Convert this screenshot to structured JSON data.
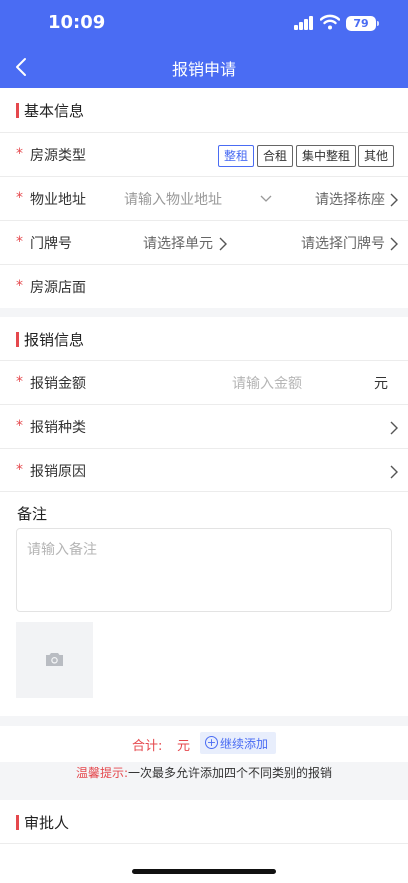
{
  "status_bar": {
    "time": "10:09",
    "battery": "79"
  },
  "nav": {
    "title": "报销申请"
  },
  "basic": {
    "title": "基本信息",
    "house_type_label": "房源类型",
    "house_types": [
      "整租",
      "合租",
      "集中整租",
      "其他"
    ],
    "address_label": "物业地址",
    "address_placeholder": "请输入物业地址",
    "building_placeholder": "请选择栋座",
    "door_label": "门牌号",
    "unit_placeholder": "请选择单元",
    "door_placeholder": "请选择门牌号",
    "store_label": "房源店面"
  },
  "reimb": {
    "title": "报销信息",
    "amount_label": "报销金额",
    "amount_placeholder": "请输入金额",
    "amount_unit": "元",
    "category_label": "报销种类",
    "reason_label": "报销原因"
  },
  "remark": {
    "label": "备注",
    "placeholder": "请输入备注"
  },
  "total": {
    "label": "合计:",
    "unit": "元",
    "add_label": "继续添加"
  },
  "tip": {
    "prefix": "温馨提示:",
    "text": "一次最多允许添加四个不同类别的报销"
  },
  "approver": {
    "title": "审批人"
  },
  "colors": {
    "primary": "#4a6cf3",
    "accent_red": "#e5484d"
  }
}
